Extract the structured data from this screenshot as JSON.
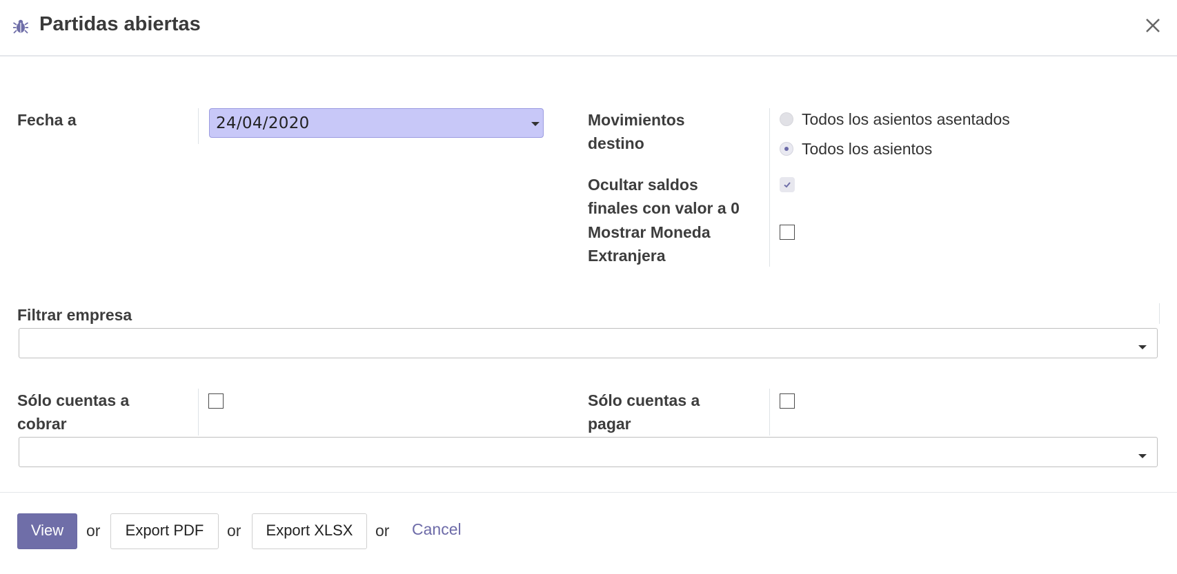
{
  "dialog": {
    "title": "Partidas abiertas",
    "close_label": "×"
  },
  "form": {
    "fecha_a": {
      "label": "Fecha a",
      "value": "24/04/2020"
    },
    "movimientos_destino": {
      "label_line1": "Movimientos",
      "label_line2": "destino",
      "options": [
        "Todos los asientos asentados",
        "Todos los asientos"
      ],
      "selected": "Todos los asientos"
    },
    "ocultar_saldos": {
      "label_line1": "Ocultar saldos",
      "label_line2": "finales con valor a 0",
      "checked": true
    },
    "mostrar_moneda": {
      "label_line1": "Mostrar Moneda",
      "label_line2": "Extranjera",
      "checked": false
    },
    "filtrar_empresa": {
      "label": "Filtrar empresa",
      "value": ""
    },
    "solo_cobrar": {
      "label_line1": "Sólo cuentas a",
      "label_line2": "cobrar",
      "checked": false
    },
    "solo_pagar": {
      "label_line1": "Sólo cuentas a",
      "label_line2": "pagar",
      "checked": false
    },
    "partner_select": {
      "value": ""
    }
  },
  "footer": {
    "view_label": "View",
    "or_label": "or",
    "export_pdf_label": "Export PDF",
    "export_xlsx_label": "Export XLSX",
    "cancel_label": "Cancel"
  },
  "colors": {
    "primary": "#6f6ea8",
    "date_field_bg": "#c8c8f8",
    "link": "#6d6ba8"
  }
}
